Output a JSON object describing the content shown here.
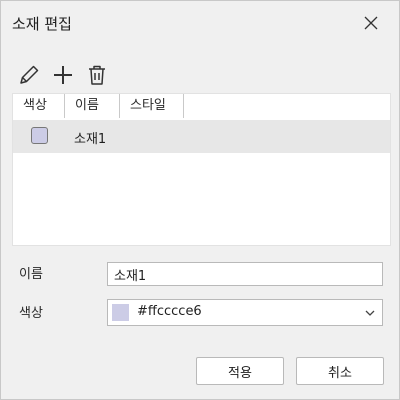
{
  "dialog": {
    "title": "소재 편집"
  },
  "toolbar": {
    "icons": [
      "pencil-icon",
      "plus-icon",
      "trash-icon"
    ]
  },
  "list": {
    "columns": [
      "색상",
      "이름",
      "스타일"
    ],
    "rows": [
      {
        "color": "#ccccE6",
        "name": "소재1"
      }
    ]
  },
  "form": {
    "name_label": "이름",
    "name_value": "소재1",
    "color_label": "색상",
    "color_value": "#ffcccce6",
    "color_swatch": "#ccccE6"
  },
  "buttons": {
    "apply": "적용",
    "cancel": "취소"
  }
}
